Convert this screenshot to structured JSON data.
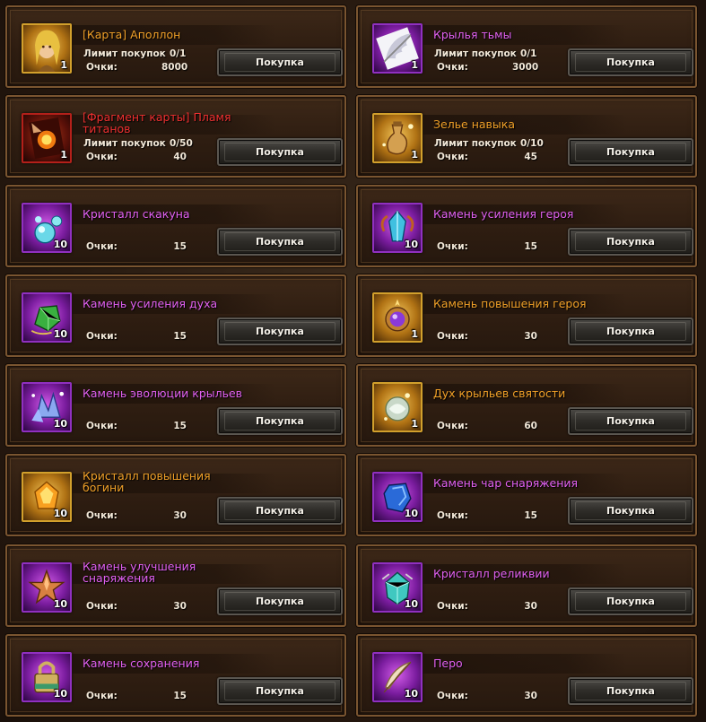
{
  "labels": {
    "limit": "Лимит покупок",
    "points": "Очки:",
    "buy": "Покупка"
  },
  "colors": {
    "gold": "#f0a028",
    "red": "#ee3030",
    "purple": "#e060f0"
  },
  "items": [
    {
      "title": "[Карта] Аполлон",
      "title_color": "gold",
      "icon": "apollo-card-portrait-icon",
      "frame": "gold",
      "qty": "1",
      "limit": "0/1",
      "points": "8000"
    },
    {
      "title": "Крылья тьмы",
      "title_color": "purple",
      "icon": "dark-wings-icon",
      "frame": "purple",
      "qty": "1",
      "limit": "0/1",
      "points": "3000"
    },
    {
      "title": "[Фрагмент карты] Пламя титанов",
      "title_color": "red",
      "icon": "titan-flame-card-fragment-icon",
      "frame": "red",
      "qty": "1",
      "limit": "0/50",
      "points": "40"
    },
    {
      "title": "Зелье навыка",
      "title_color": "gold",
      "icon": "skill-potion-icon",
      "frame": "gold",
      "qty": "1",
      "limit": "0/10",
      "points": "45"
    },
    {
      "title": "Кристалл скакуна",
      "title_color": "purple",
      "icon": "mount-crystal-icon",
      "frame": "purple",
      "qty": "10",
      "limit": "",
      "points": "15"
    },
    {
      "title": "Камень усиления героя",
      "title_color": "purple",
      "icon": "hero-enhance-stone-icon",
      "frame": "purple",
      "qty": "10",
      "limit": "",
      "points": "15"
    },
    {
      "title": "Камень усиления духа",
      "title_color": "purple",
      "icon": "spirit-enhance-stone-icon",
      "frame": "purple",
      "qty": "10",
      "limit": "",
      "points": "15"
    },
    {
      "title": "Камень повышения героя",
      "title_color": "gold",
      "icon": "hero-upgrade-stone-icon",
      "frame": "gold",
      "qty": "1",
      "limit": "",
      "points": "30"
    },
    {
      "title": "Камень эволюции крыльев",
      "title_color": "purple",
      "icon": "wing-evolution-stone-icon",
      "frame": "purple",
      "qty": "10",
      "limit": "",
      "points": "15"
    },
    {
      "title": "Дух крыльев святости",
      "title_color": "gold",
      "icon": "holy-wing-spirit-icon",
      "frame": "gold",
      "qty": "1",
      "limit": "",
      "points": "60"
    },
    {
      "title": "Кристалл повышения богини",
      "title_color": "gold",
      "icon": "goddess-upgrade-crystal-icon",
      "frame": "gold",
      "qty": "10",
      "limit": "",
      "points": "30"
    },
    {
      "title": "Камень чар снаряжения",
      "title_color": "purple",
      "icon": "equipment-enchant-stone-icon",
      "frame": "purple",
      "qty": "10",
      "limit": "",
      "points": "15"
    },
    {
      "title": "Камень улучшения снаряжения",
      "title_color": "purple",
      "icon": "equipment-upgrade-stone-icon",
      "frame": "purple",
      "qty": "10",
      "limit": "",
      "points": "30"
    },
    {
      "title": "Кристалл реликвии",
      "title_color": "purple",
      "icon": "relic-crystal-icon",
      "frame": "purple",
      "qty": "10",
      "limit": "",
      "points": "30"
    },
    {
      "title": "Камень сохранения",
      "title_color": "purple",
      "icon": "preservation-stone-icon",
      "frame": "purple",
      "qty": "10",
      "limit": "",
      "points": "15"
    },
    {
      "title": "Перо",
      "title_color": "purple",
      "icon": "feather-icon",
      "frame": "purple",
      "qty": "10",
      "limit": "",
      "points": "30"
    }
  ]
}
